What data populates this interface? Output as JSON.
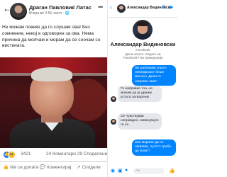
{
  "post": {
    "author": "Драган Павловиќ Латас",
    "meta": "Вчера во 2:56 часот · 🌐",
    "text": "Не можам повеќе да го слушам ова! Без сомнение, некој е одговорен за ова. Нема причина да молчам и морам да се соочам со вистината.",
    "reaction_count": "3421",
    "comments": "24 Коментари",
    "shares": "29 Споделени",
    "actions": {
      "like": "Ми се допаѓа",
      "comment": "Коментирај",
      "share": "Сподели"
    },
    "icons": [
      "back-arrow-icon",
      "more-icon",
      "like-icon",
      "comment-icon",
      "share-icon"
    ]
  },
  "messenger": {
    "header_name": "Александар Видиновски",
    "profile_name": "Александар Видиновски",
    "profile_sub_lines": [
      "Facebook",
      "Дали некого гледате на",
      "Facebook? Во Македонија"
    ],
    "messages": [
      {
        "from": "me",
        "text": "Не разбирам зошто некерфсмот беше молчен. Дали го направи ова?"
      },
      {
        "from": "them",
        "text": "Го направив тоа, не можам да ја држам устата затворена!"
      },
      {
        "from": "them",
        "text": "Се чувствував неправдно, извинувајте ги се."
      },
      {
        "from": "me",
        "text": "Зоа морале да се направи, лутото треба да знаат!"
      }
    ],
    "composer_placeholder": "Aa",
    "accent": "#0084ff"
  }
}
